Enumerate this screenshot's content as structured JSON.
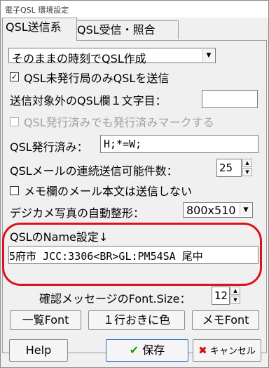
{
  "window": {
    "title": "電子QSL 環境設定"
  },
  "tabs": [
    {
      "label": "QSL送信系"
    },
    {
      "label": "QSL受信・照合"
    }
  ],
  "qsl_send": {
    "mode_select": {
      "value": "そのままの時刻でQSL作成"
    },
    "only_unissued": {
      "label": "QSL未発行局のみQSLを送信",
      "checked": true
    },
    "exclude_char": {
      "label": "送信対象外のQSL欄１文字目：",
      "value": ""
    },
    "mark_issued_again": {
      "label": "QSL発行済みでも発行済みマークする",
      "checked": false,
      "disabled": true
    },
    "issued": {
      "label": "QSL発行済み：",
      "value": "H;*=W;"
    },
    "continuous_send": {
      "label": "QSLメールの連続送信可能件数：",
      "value": "25"
    },
    "memo_no_body": {
      "label": "メモ欄のメール本文は送信しない",
      "checked": false
    },
    "photo_resize": {
      "label": "デジカメ写真の自動整形：",
      "value": "800x510"
    },
    "name_setting": {
      "label": "QSLのName設定↓",
      "value": "5府市 JCC:3306<BR>GL:PM54SA 尾中"
    },
    "font_size": {
      "label": "確認メッセージのFont.Size：",
      "value": "12"
    }
  },
  "buttons": {
    "list_font": "一覧Font",
    "alternate_color": "１行おきに色",
    "memo_font": "メモFont",
    "help": "Help",
    "save": "保存",
    "cancel": "キャンセル"
  },
  "colors": {
    "highlight": "#e0101a",
    "save_check": "#1a9a1a",
    "cancel_x": "#d01010"
  }
}
